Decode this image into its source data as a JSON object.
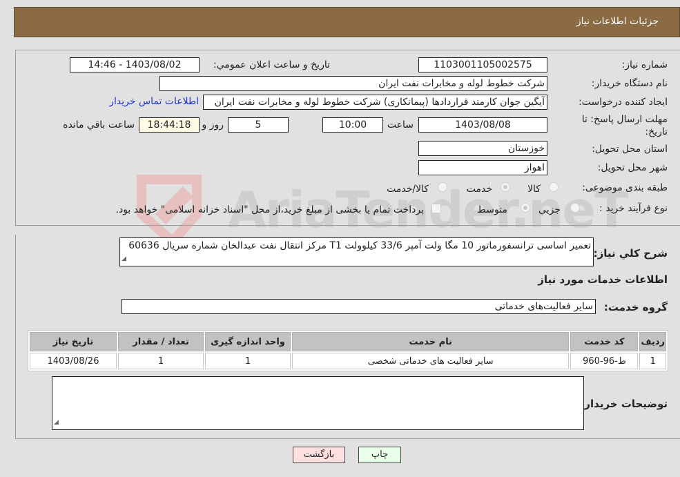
{
  "header": {
    "title": "جزئیات اطلاعات نیاز"
  },
  "form": {
    "need_number": {
      "label": "شماره نیاز:",
      "value": "1103001105002575"
    },
    "announce": {
      "label": "تاریخ و ساعت اعلان عمومي:",
      "value": "1403/08/02 - 14:46"
    },
    "buyer_org": {
      "label": "نام دستگاه خریدار:",
      "value": "شرکت خطوط لوله و مخابرات نفت ایران"
    },
    "creator": {
      "label": "ایجاد کننده درخواست:",
      "value": "آیگین  جوان کارمند قراردادها (پیمانکاری) شرکت خطوط لوله و مخابرات نفت ایران",
      "contact_link": "اطلاعات تماس خریدار"
    },
    "deadline": {
      "label": "مهلت ارسال پاسخ: تا تاریخ:",
      "date": "1403/08/08",
      "time_label": "ساعت",
      "time": "10:00",
      "days": "5",
      "days_label": "روز و",
      "remaining": "18:44:18",
      "remaining_label": "ساعت باقي مانده"
    },
    "province": {
      "label": "استان محل تحویل:",
      "value": "خوزستان"
    },
    "city": {
      "label": "شهر محل تحویل:",
      "value": "اهواز"
    },
    "category": {
      "label": "طبقه بندی موضوعی:",
      "options": [
        {
          "label": "کالا",
          "checked": false
        },
        {
          "label": "خدمت",
          "checked": true
        },
        {
          "label": "کالا/خدمت",
          "checked": false
        }
      ]
    },
    "purchase_type": {
      "label": "نوع فرآیند خرید :",
      "options": [
        {
          "label": "جزیي",
          "checked": false
        },
        {
          "label": "متوسط",
          "checked": true
        }
      ],
      "treasury_note": "پرداخت تمام یا بخشی از مبلغ خرید،از محل \"اسناد خزانه اسلامی\" خواهد بود."
    }
  },
  "description": {
    "label": "شرح کلي نیاز:",
    "value": "تعمیر اساسی ترانسفورماتور 10 مگا ولت آمپر 33/6 کیلوولت T1 مرکز انتقال نفت عبدالخان شماره سریال 60636"
  },
  "services_section": {
    "title": "اطلاعات خدمات مورد نیاز"
  },
  "service_group": {
    "label": "گروه خدمت:",
    "value": "سایر فعالیت‌های خدماتی"
  },
  "table": {
    "headers": [
      "ردیف",
      "کد خدمت",
      "نام خدمت",
      "واحد اندازه گیری",
      "تعداد / مقدار",
      "تاریخ نیاز"
    ],
    "rows": [
      [
        "1",
        "ط-96-960",
        "سایر فعالیت های خدماتی شخصی",
        "1",
        "1",
        "1403/08/26"
      ]
    ]
  },
  "buyer_notes": {
    "label": "توضیحات خریدار:",
    "value": ""
  },
  "buttons": {
    "print": "چاپ",
    "back": "بازگشت"
  },
  "watermark": {
    "text": "AriaTender.neT"
  }
}
